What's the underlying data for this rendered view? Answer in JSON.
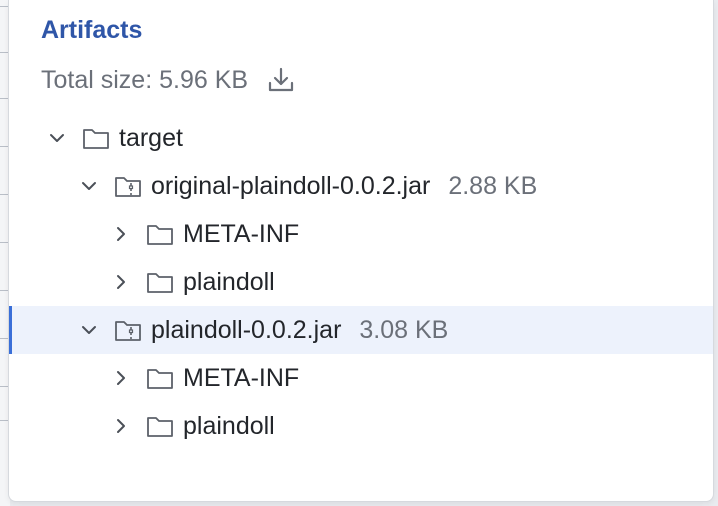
{
  "artifacts": {
    "title": "Artifacts",
    "total_size_text": "Total size: 5.96 KB",
    "download_icon": "download-icon"
  },
  "tree": [
    {
      "name": "target",
      "type": "folder",
      "expanded": true,
      "depth": 0
    },
    {
      "name": "original-plaindoll-0.0.2.jar",
      "type": "archive",
      "size": "2.88 KB",
      "expanded": true,
      "depth": 1
    },
    {
      "name": "META-INF",
      "type": "folder",
      "expanded": false,
      "depth": 2
    },
    {
      "name": "plaindoll",
      "type": "folder",
      "expanded": false,
      "depth": 2
    },
    {
      "name": "plaindoll-0.0.2.jar",
      "type": "archive",
      "size": "3.08 KB",
      "expanded": true,
      "depth": 1,
      "selected": true
    },
    {
      "name": "META-INF",
      "type": "folder",
      "expanded": false,
      "depth": 2
    },
    {
      "name": "plaindoll",
      "type": "folder",
      "expanded": false,
      "depth": 2
    }
  ],
  "colors": {
    "title": "#2f56a8",
    "selection_bg": "#edf2fc",
    "selection_bar": "#3a6fd8",
    "muted_text": "#6b7079"
  }
}
